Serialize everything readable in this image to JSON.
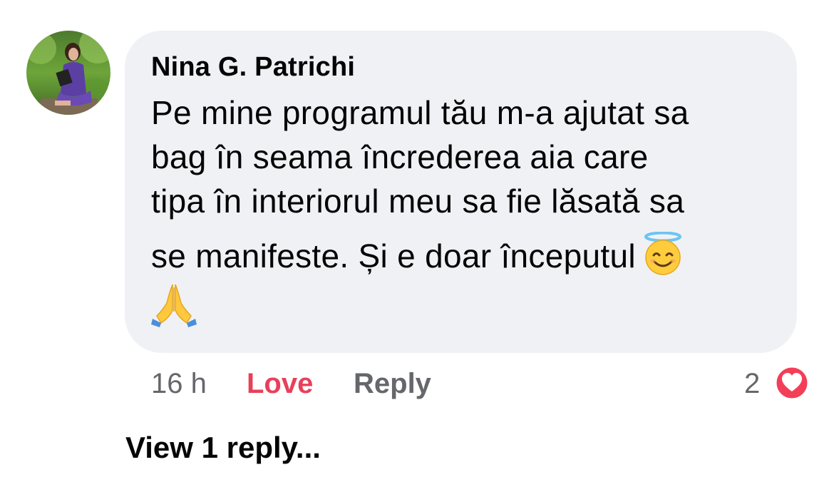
{
  "comment": {
    "author": "Nina G. Patrichi",
    "lines": [
      "Pe mine programul tău m-a ajutat sa",
      "bag în seama încrederea aia care",
      "tipa în interiorul meu sa fie lăsată sa",
      "se manifeste. Și e doar începutul"
    ],
    "emojis": [
      "smiling-face-with-halo-icon",
      "folded-hands-icon"
    ]
  },
  "actions": {
    "time": "16 h",
    "love": "Love",
    "reply": "Reply"
  },
  "reactions": {
    "count": "2",
    "icon": "heart-icon"
  },
  "replies": {
    "view_label": "View 1 reply..."
  },
  "colors": {
    "bubble": "#f0f1f5",
    "love": "#e8405a",
    "muted": "#65676b",
    "text": "#050505"
  }
}
